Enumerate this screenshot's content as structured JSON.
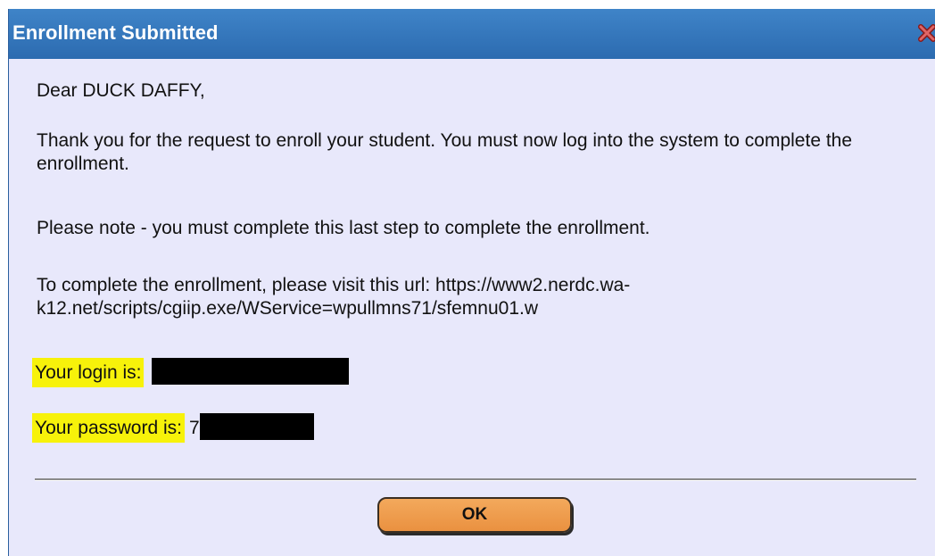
{
  "dialog": {
    "title": "Enrollment Submitted",
    "close_icon": "close-x-icon"
  },
  "message": {
    "greeting": "Dear DUCK DAFFY,",
    "paragraph1": "Thank you for the request to enroll your student. You must now log into the system to complete the enrollment.",
    "paragraph2": "Please note - you must complete this last step to complete the enrollment.",
    "paragraph3": "To complete the enrollment, please visit this url: https://www2.nerdc.wa-k12.net/scripts/cgiip.exe/WService=wpullmns71/sfemnu01.w",
    "login_label": "Your login is:",
    "password_label": "Your password is:",
    "password_visible_prefix": "7"
  },
  "buttons": {
    "ok_label": "OK"
  },
  "colors": {
    "titlebar": "#2c6bb0",
    "dialog_background": "#e8e8fb",
    "highlight": "#f7f20a",
    "button": "#ea9140"
  }
}
